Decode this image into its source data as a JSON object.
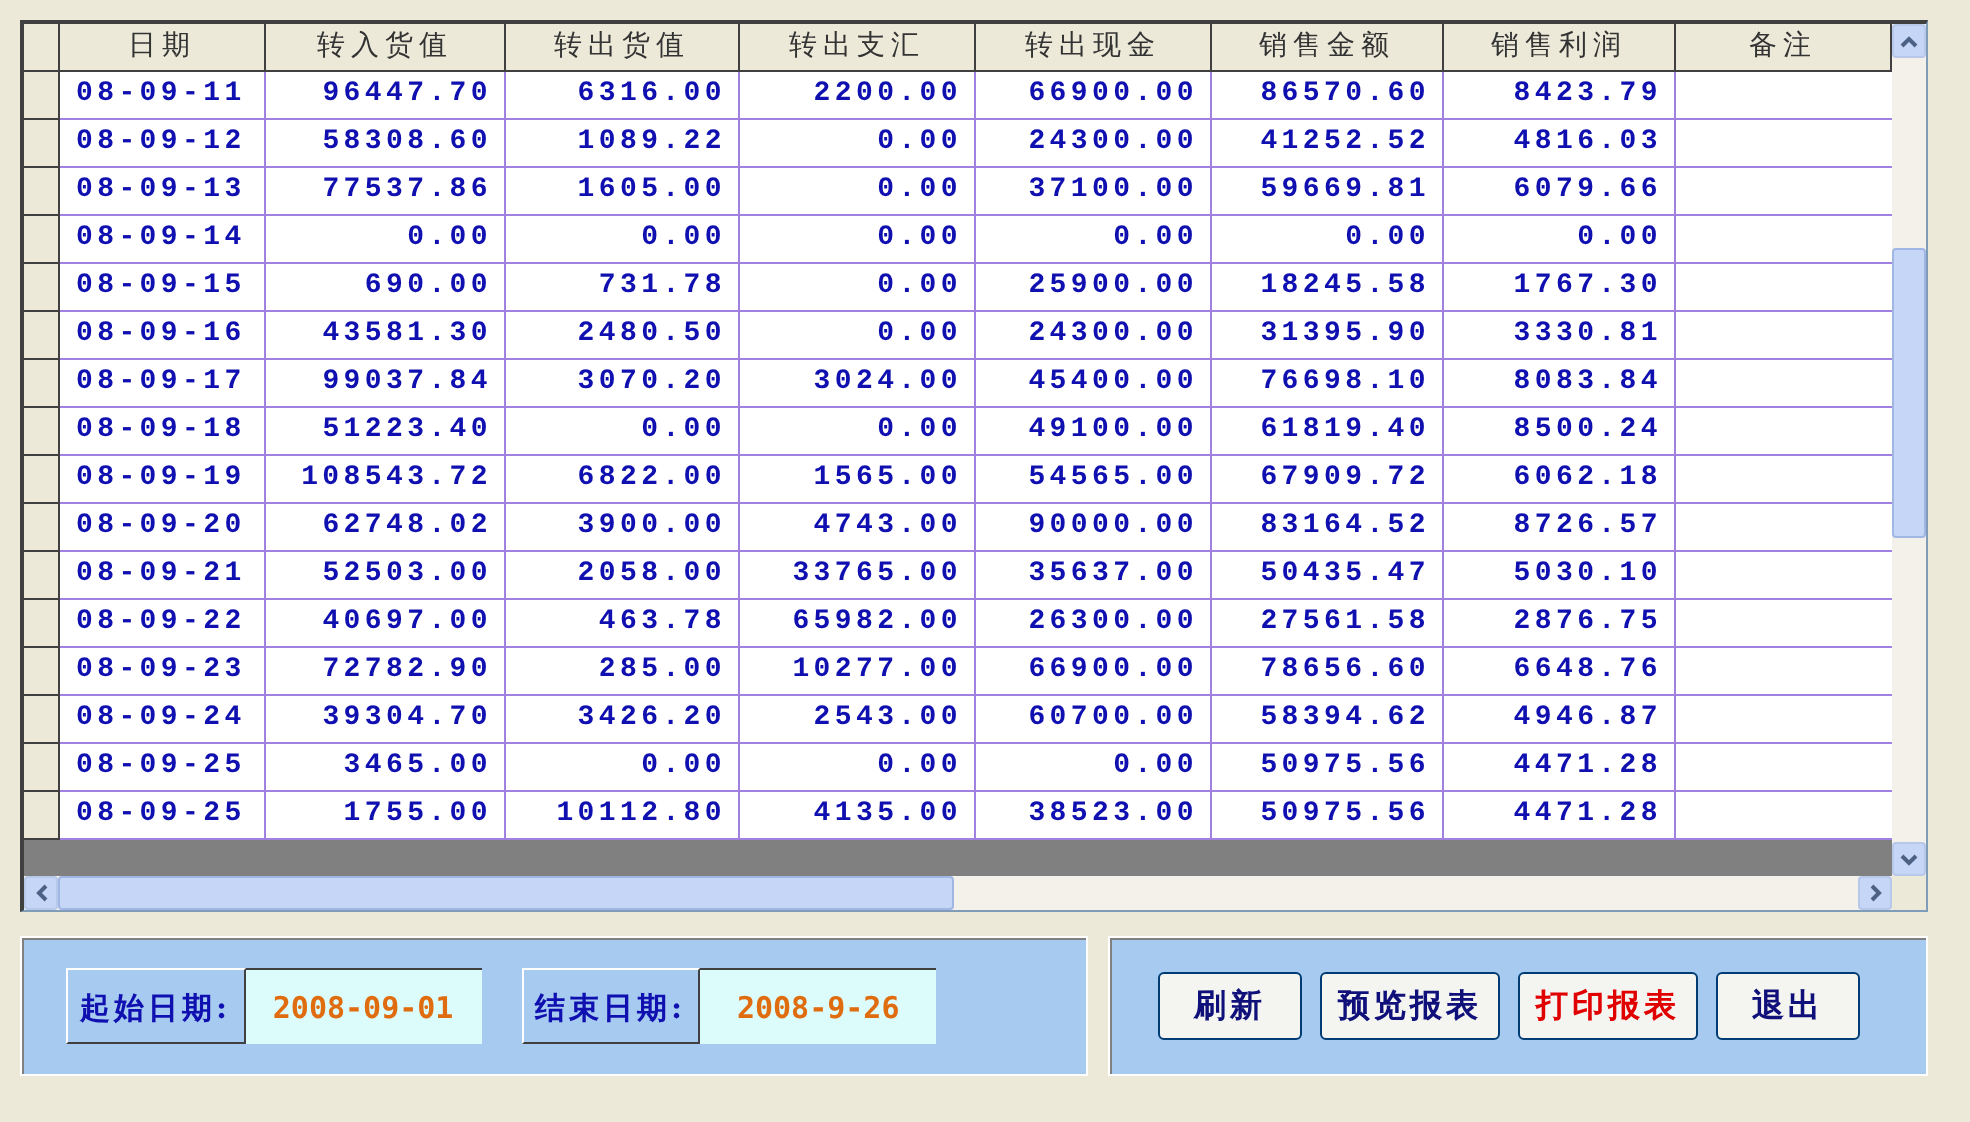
{
  "table": {
    "columns": [
      "日期",
      "转入货值",
      "转出货值",
      "转出支汇",
      "转出现金",
      "销售金额",
      "销售利润",
      "备注"
    ],
    "rows": [
      {
        "cells": [
          "08-09-11",
          "96447.70",
          "6316.00",
          "2200.00",
          "66900.00",
          "86570.60",
          "8423.79"
        ]
      },
      {
        "cells": [
          "08-09-12",
          "58308.60",
          "1089.22",
          "0.00",
          "24300.00",
          "41252.52",
          "4816.03"
        ]
      },
      {
        "cells": [
          "08-09-13",
          "77537.86",
          "1605.00",
          "0.00",
          "37100.00",
          "59669.81",
          "6079.66"
        ]
      },
      {
        "cells": [
          "08-09-14",
          "0.00",
          "0.00",
          "0.00",
          "0.00",
          "0.00",
          "0.00"
        ]
      },
      {
        "cells": [
          "08-09-15",
          "690.00",
          "731.78",
          "0.00",
          "25900.00",
          "18245.58",
          "1767.30"
        ]
      },
      {
        "cells": [
          "08-09-16",
          "43581.30",
          "2480.50",
          "0.00",
          "24300.00",
          "31395.90",
          "3330.81"
        ]
      },
      {
        "cells": [
          "08-09-17",
          "99037.84",
          "3070.20",
          "3024.00",
          "45400.00",
          "76698.10",
          "8083.84"
        ]
      },
      {
        "cells": [
          "08-09-18",
          "51223.40",
          "0.00",
          "0.00",
          "49100.00",
          "61819.40",
          "8500.24"
        ]
      },
      {
        "cells": [
          "08-09-19",
          "108543.72",
          "6822.00",
          "1565.00",
          "54565.00",
          "67909.72",
          "6062.18"
        ]
      },
      {
        "cells": [
          "08-09-20",
          "62748.02",
          "3900.00",
          "4743.00",
          "90000.00",
          "83164.52",
          "8726.57"
        ]
      },
      {
        "cells": [
          "08-09-21",
          "52503.00",
          "2058.00",
          "33765.00",
          "35637.00",
          "50435.47",
          "5030.10"
        ]
      },
      {
        "cells": [
          "08-09-22",
          "40697.00",
          "463.78",
          "65982.00",
          "26300.00",
          "27561.58",
          "2876.75"
        ]
      },
      {
        "cells": [
          "08-09-23",
          "72782.90",
          "285.00",
          "10277.00",
          "66900.00",
          "78656.60",
          "6648.76"
        ]
      },
      {
        "cells": [
          "08-09-24",
          "39304.70",
          "3426.20",
          "2543.00",
          "60700.00",
          "58394.62",
          "4946.87"
        ]
      },
      {
        "cells": [
          "08-09-25",
          "3465.00",
          "0.00",
          "0.00",
          "0.00",
          "50975.56",
          "4471.28"
        ]
      },
      {
        "cells": [
          "08-09-25",
          "1755.00",
          "10112.80",
          "4135.00",
          "38523.00",
          "50975.56",
          "4471.28"
        ]
      }
    ]
  },
  "date_range": {
    "start_label": "起始日期:",
    "start_value": "2008-09-01",
    "end_label": "结束日期:",
    "end_value": "2008-9-26"
  },
  "buttons": [
    {
      "label": "刷新",
      "kind": "normal"
    },
    {
      "label": "预览报表",
      "kind": "normal"
    },
    {
      "label": "打印报表",
      "kind": "warning"
    },
    {
      "label": "退出",
      "kind": "normal"
    }
  ]
}
